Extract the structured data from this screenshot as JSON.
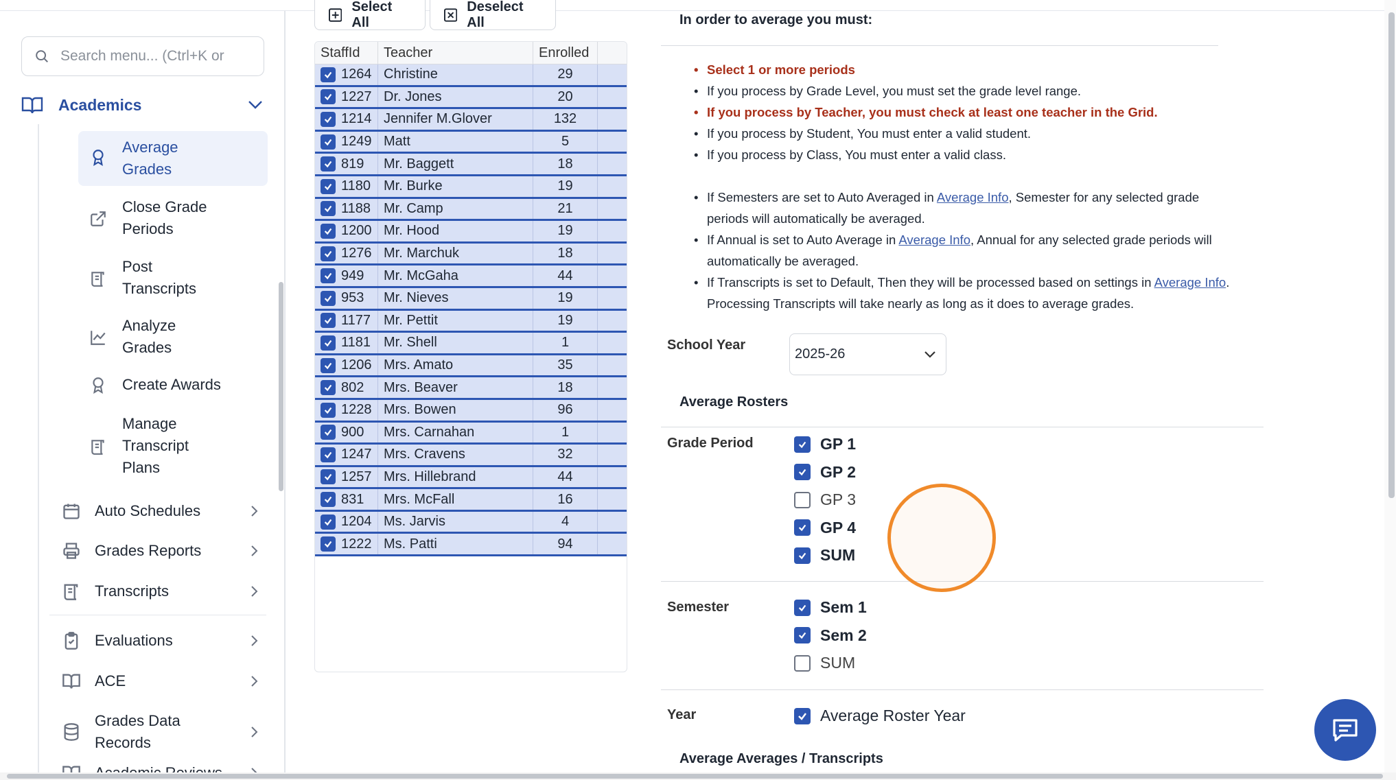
{
  "sidebar": {
    "search_placeholder": "Search menu... (Ctrl+K or",
    "section": "Academics",
    "subitems": [
      {
        "label": "Average\nGrades"
      },
      {
        "label": "Close Grade\nPeriods"
      },
      {
        "label": "Post\nTranscripts"
      },
      {
        "label": "Analyze\nGrades"
      },
      {
        "label": "Create Awards"
      },
      {
        "label": "Manage\nTranscript\nPlans"
      }
    ],
    "nav": [
      {
        "label": "Auto Schedules"
      },
      {
        "label": "Grades Reports"
      },
      {
        "label": "Transcripts"
      },
      {
        "label": "Evaluations"
      },
      {
        "label": "ACE"
      },
      {
        "label": "Grades Data\nRecords"
      },
      {
        "label": "Academic Reviews"
      }
    ]
  },
  "toolbar": {
    "select_all": "Select All",
    "deselect_all": "Deselect All"
  },
  "grid": {
    "columns": [
      "StaffId",
      "Teacher",
      "Enrolled"
    ],
    "rows": [
      {
        "id": "1264",
        "teacher": "Christine",
        "enrolled": "29"
      },
      {
        "id": "1227",
        "teacher": "Dr. Jones",
        "enrolled": "20"
      },
      {
        "id": "1214",
        "teacher": "Jennifer M.Glover",
        "enrolled": "132"
      },
      {
        "id": "1249",
        "teacher": "Matt",
        "enrolled": "5"
      },
      {
        "id": "819",
        "teacher": "Mr. Baggett",
        "enrolled": "18"
      },
      {
        "id": "1180",
        "teacher": "Mr. Burke",
        "enrolled": "19"
      },
      {
        "id": "1188",
        "teacher": "Mr. Camp",
        "enrolled": "21"
      },
      {
        "id": "1200",
        "teacher": "Mr. Hood",
        "enrolled": "19"
      },
      {
        "id": "1276",
        "teacher": "Mr. Marchuk",
        "enrolled": "18"
      },
      {
        "id": "949",
        "teacher": "Mr. McGaha",
        "enrolled": "44"
      },
      {
        "id": "953",
        "teacher": "Mr. Nieves",
        "enrolled": "19"
      },
      {
        "id": "1177",
        "teacher": "Mr. Pettit",
        "enrolled": "19"
      },
      {
        "id": "1181",
        "teacher": "Mr. Shell",
        "enrolled": "1"
      },
      {
        "id": "1206",
        "teacher": "Mrs. Amato",
        "enrolled": "35"
      },
      {
        "id": "802",
        "teacher": "Mrs. Beaver",
        "enrolled": "18"
      },
      {
        "id": "1228",
        "teacher": "Mrs. Bowen",
        "enrolled": "96"
      },
      {
        "id": "900",
        "teacher": "Mrs. Carnahan",
        "enrolled": "1"
      },
      {
        "id": "1247",
        "teacher": "Mrs. Cravens",
        "enrolled": "32"
      },
      {
        "id": "1257",
        "teacher": "Mrs. Hillebrand",
        "enrolled": "44"
      },
      {
        "id": "831",
        "teacher": "Mrs. McFall",
        "enrolled": "16"
      },
      {
        "id": "1204",
        "teacher": "Ms. Jarvis",
        "enrolled": "4"
      },
      {
        "id": "1222",
        "teacher": "Ms. Patti",
        "enrolled": "94"
      }
    ]
  },
  "info": {
    "heading": "In order to average you must:",
    "req1": "Select 1 or more periods",
    "req2": "If you process by Grade Level, you must set the grade level range.",
    "req3": "If you process by Teacher, you must check at least one teacher in the Grid.",
    "req4": "If you process by Student, You must enter a valid student.",
    "req5": "If you process by Class, You must enter a valid class.",
    "n1a": "If Semesters are set to Auto Averaged in ",
    "n1link": "Average Info",
    "n1b": ", Semester for any selected grade periods will automatically be averaged.",
    "n2a": "If Annual is set to Auto Average in ",
    "n2link": "Average Info",
    "n2b": ", Annual for any selected grade periods will automatically be averaged.",
    "n3a": "If Transcripts is set to Default, Then they will be processed based on settings in ",
    "n3link": "Average Info",
    "n3b": ". Processing Transcripts will take nearly as long as it does to average grades."
  },
  "form": {
    "school_year_label": "School Year",
    "school_year_value": "2025-26",
    "avg_rosters_heading": "Average Rosters",
    "grade_period_label": "Grade Period",
    "grade_periods": [
      {
        "label": "GP 1",
        "checked": true
      },
      {
        "label": "GP 2",
        "checked": true
      },
      {
        "label": "GP 3",
        "checked": false
      },
      {
        "label": "GP 4",
        "checked": true
      },
      {
        "label": "SUM",
        "checked": true
      }
    ],
    "semester_label": "Semester",
    "semesters": [
      {
        "label": "Sem 1",
        "checked": true
      },
      {
        "label": "Sem 2",
        "checked": true
      },
      {
        "label": "SUM",
        "checked": false
      }
    ],
    "year_label": "Year",
    "year_option": "Average Roster Year",
    "avg_transcripts_heading": "Average Averages / Transcripts"
  },
  "colors": {
    "accent": "#2d56b2",
    "error": "#a8301a",
    "highlight": "#f08a2a"
  }
}
